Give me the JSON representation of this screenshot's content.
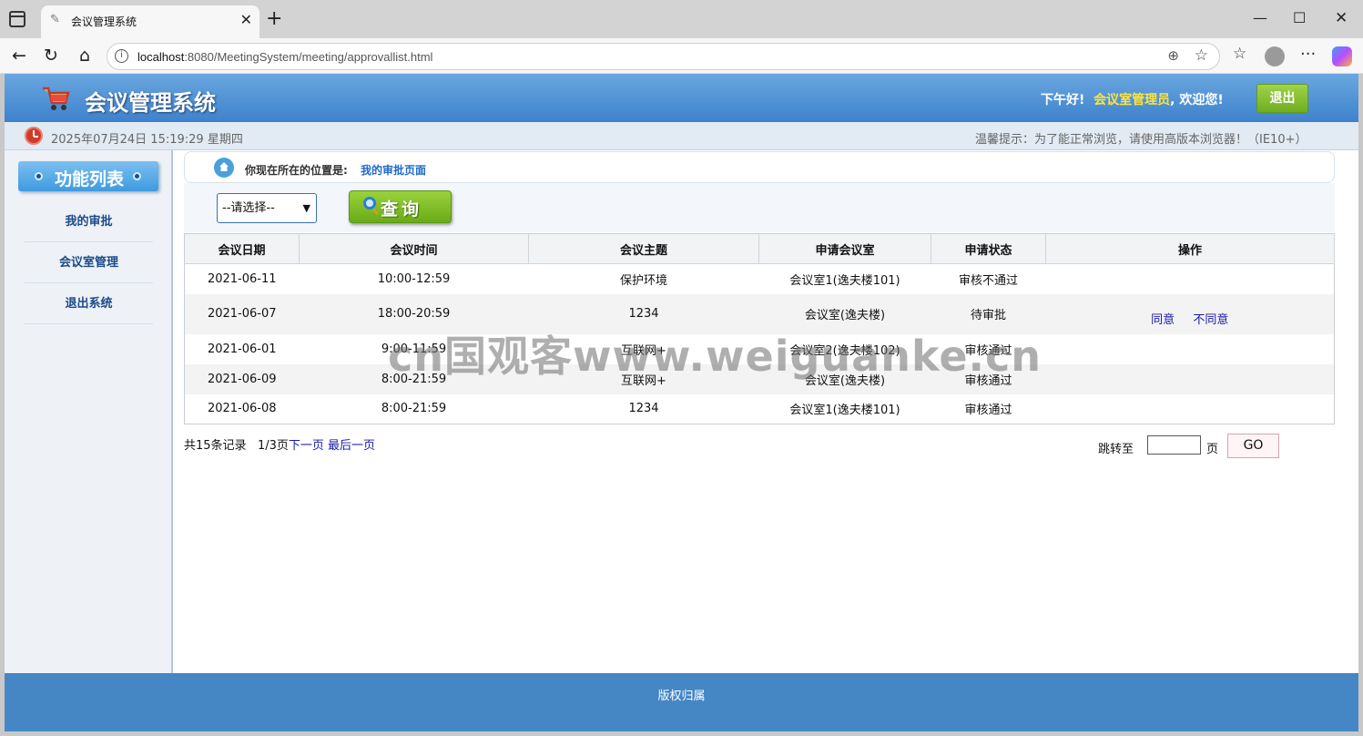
{
  "browser": {
    "tab_title": "会议管理系统",
    "url_host": "localhost",
    "url_rest": ":8080/MeetingSystem/meeting/approvallist.html"
  },
  "header": {
    "title": "会议管理系统",
    "greeting": "下午好!",
    "role": "会议室管理员",
    "welcome": ", 欢迎您!",
    "logout": "退出"
  },
  "infobar": {
    "datetime": "2025年07月24日 15:19:29 星期四",
    "tip": "温馨提示：为了能正常浏览，请使用高版本浏览器！（IE10+）"
  },
  "sidebar": {
    "title": "功能列表",
    "items": [
      {
        "label": "我的审批"
      },
      {
        "label": "会议室管理"
      },
      {
        "label": "退出系统"
      }
    ]
  },
  "breadcrumb": {
    "label": "你现在所在的位置是:",
    "current": "我的审批页面"
  },
  "toolbar": {
    "select_value": "--请选择--",
    "query_label": "查询"
  },
  "table": {
    "headers": [
      "会议日期",
      "会议时间",
      "会议主题",
      "申请会议室",
      "申请状态",
      "操作"
    ],
    "rows": [
      {
        "date": "2021-06-11",
        "time": "10:00-12:59",
        "topic": "保护环境",
        "room": "会议室1(逸夫楼101)",
        "status": "审核不通过",
        "actions": []
      },
      {
        "date": "2021-06-07",
        "time": "18:00-20:59",
        "topic": "1234",
        "room": "会议室(逸夫楼)",
        "status": "待审批",
        "actions": [
          "同意",
          "不同意"
        ]
      },
      {
        "date": "2021-06-01",
        "time": "9:00-11:59",
        "topic": "互联网+",
        "room": "会议室2(逸夫楼102)",
        "status": "审核通过",
        "actions": []
      },
      {
        "date": "2021-06-09",
        "time": "8:00-21:59",
        "topic": "互联网+",
        "room": "会议室(逸夫楼)",
        "status": "审核通过",
        "actions": []
      },
      {
        "date": "2021-06-08",
        "time": "8:00-21:59",
        "topic": "1234",
        "room": "会议室1(逸夫楼101)",
        "status": "审核通过",
        "actions": []
      }
    ]
  },
  "pager": {
    "total": "共15条记录",
    "page": "1/3页",
    "next": "下一页",
    "last": "最后一页",
    "jump_label": "跳转至",
    "jump_unit": "页",
    "go": "GO"
  },
  "footer": {
    "text": "版权归属"
  },
  "watermark": "cn国观客www.weiguanke.cn"
}
